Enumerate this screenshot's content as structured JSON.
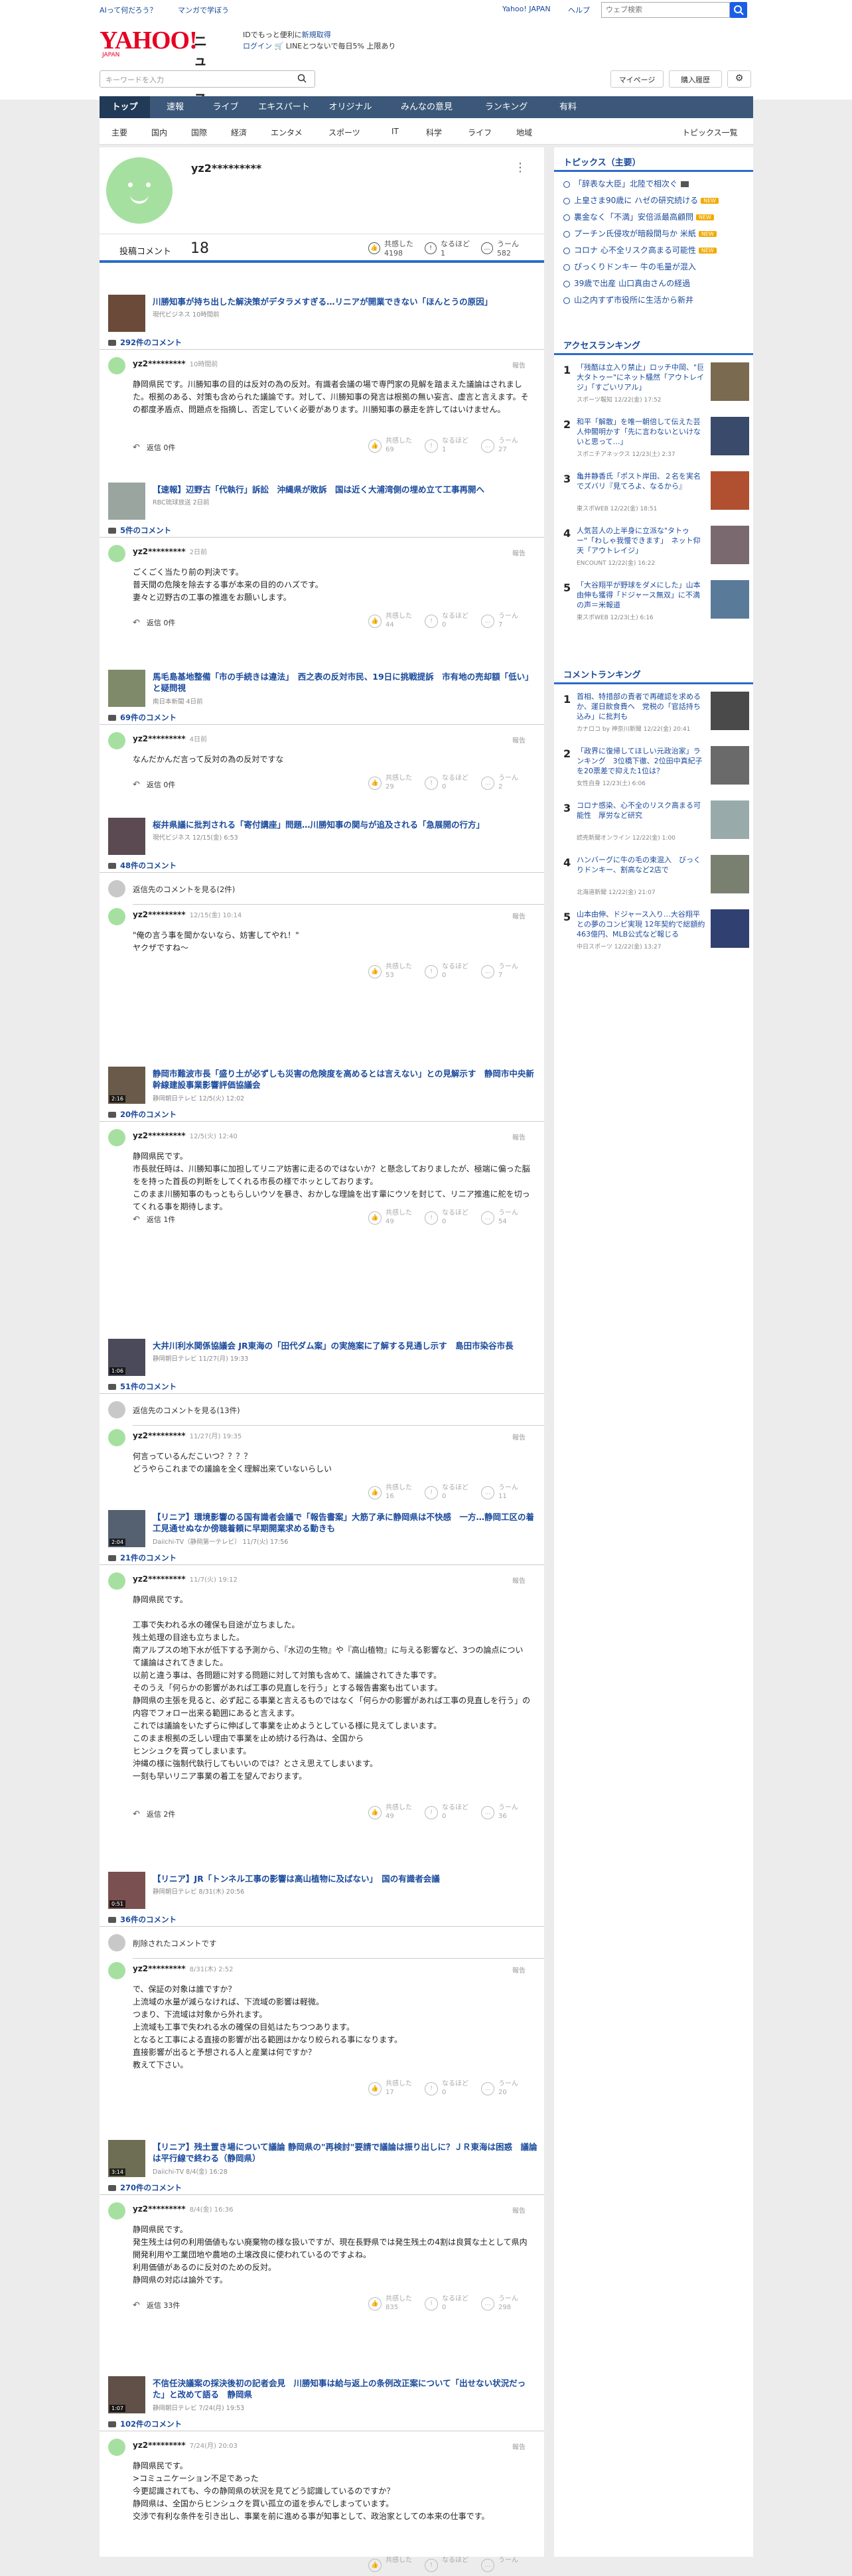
{
  "header": {
    "util_left": [
      "AIって何だろう？",
      "マンガで学ぼう"
    ],
    "util_right": [
      "Yahoo! JAPAN",
      "ヘルプ"
    ],
    "search_placeholder": "ウェブ検索",
    "logo": "YAHOO!",
    "logo_sub": "JAPAN",
    "logo_news": "ニュース",
    "promo_line1": "IDでもっと便利に",
    "promo_line1_link": "新規取得",
    "promo_line2_link": "ログイン",
    "promo_line2": "🛒 LINEとつないで毎日5% ",
    "promo_line2_tail": "上限あり",
    "keyword_placeholder": "キーワードを入力",
    "mypage": "マイページ",
    "subscribe": "購入履歴"
  },
  "nav": [
    "トップ",
    "速報",
    "ライブ",
    "エキスパート",
    "オリジナル",
    "みんなの意見",
    "ランキング",
    "有料"
  ],
  "subnav": [
    "主要",
    "国内",
    "国際",
    "経済",
    "エンタメ",
    "スポーツ",
    "IT",
    "科学",
    "ライフ",
    "地域"
  ],
  "subnav_right": "トピックス一覧",
  "profile": {
    "name": "yz2*********",
    "menu": "⋮",
    "posts_label": "投稿コメント",
    "posts": "18",
    "r1_label": "共感した",
    "r1": "4198",
    "r2_label": "なるほど",
    "r2": "1",
    "r3_label": "うーん",
    "r3": "582"
  },
  "articles": [
    {
      "title": "川勝知事が持ち出した解決策がデタラメすぎる…リニアが開業できない「ほんとうの原因」",
      "src": "現代ビジネス 10時間前",
      "count": "292件のコメント",
      "user": "yz2*********",
      "time": "10時間前",
      "body": "静岡県民です。川勝知事の目的は反対の為の反対。有識者会議の場で専門家の見解を踏まえた議論はされました。根拠のある、対策も含められた議論です。対して、川勝知事の発言は根拠の無い妄言、虚言と言えます。その都度矛盾点、問題点を指摘し、否定していく必要があります。川勝知事の暴走を許してはいけません。",
      "reply": "返信 0件",
      "v1": "69",
      "v2": "1",
      "v3": "27"
    },
    {
      "title": "【速報】辺野古「代執行」訴訟　沖縄県が敗訴　国は近く大浦湾側の埋め立て工事再開へ",
      "src": "RBC琉球放送 2日前",
      "count": "5件のコメント",
      "user": "yz2*********",
      "time": "2日前",
      "body": "ごくごく当たり前の判決です。\n普天間の危険を除去する事が本来の目的のハズです。\n妻々と辺野古の工事の推進をお願いします。",
      "reply": "返信 0件",
      "v1": "44",
      "v2": "0",
      "v3": "7"
    },
    {
      "title": "馬毛島基地整備「市の手続きは違法」　西之表の反対市民、19日に挑戦提訴　市有地の売却額「低い」と疑問視",
      "src": "南日本新聞 4日前",
      "count": "69件のコメント",
      "user": "yz2*********",
      "time": "4日前",
      "body": "なんだかんだ言って反対の為の反対ですな",
      "reply": "返信 0件",
      "v1": "29",
      "v2": "0",
      "v3": "2"
    },
    {
      "title": "桜井県議に批判される「寄付講座」問題…川勝知事の関与が追及される「急展開の行方」",
      "src": "現代ビジネス 12/15(金) 6:53",
      "count": "48件のコメント",
      "see": "返信先のコメントを見る(2件)",
      "user": "yz2*********",
      "time": "12/15(金) 10:14",
      "body": "\"俺の言う事を聞かないなら、妨害してやれ！\"\nヤクザですね〜",
      "v1": "53",
      "v2": "0",
      "v3": "7"
    },
    {
      "title": "静岡市難波市長「盛り土が必ずしも災害の危険度を高めるとは言えない」との見解示す　静岡市中央新幹線建設事業影響評価協議会",
      "src": "静岡朝日テレビ 12/5(火) 12:02",
      "dur": "2:16",
      "count": "20件のコメント",
      "user": "yz2*********",
      "time": "12/5(火) 12:40",
      "body": "静岡県民です。\n市長就任時は、川勝知事に加担してリニア妨害に走るのではないか？と懸念しておりましたが、極端に偏った脳をを持った首長の判断をしてくれる市長の様でホッとしております。\nこのまま川勝知事のもっともらしいウソを暴き、おかしな理論を出す輩にウソを封じて、リニア推進に舵を切ってくれる事を期待します。",
      "reply": "返信 1件",
      "v1": "49",
      "v2": "0",
      "v3": "54"
    },
    {
      "title": "大井川利水関係協議会 JR東海の「田代ダム案」の実施案に了解する見通し示す　島田市染谷市長",
      "src": "静岡朝日テレビ 11/27(月) 19:33",
      "dur": "1:06",
      "count": "51件のコメント",
      "see": "返信先のコメントを見る(13件)",
      "user": "yz2*********",
      "time": "11/27(月) 19:35",
      "body": "何言っているんだこいつ？？？？\nどうやらこれまでの議論を全く理解出来ていないらしい",
      "v1": "16",
      "v2": "0",
      "v3": "11"
    },
    {
      "title": "【リニア】環境影響のる国有識者会議で「報告書案」大筋了承に静岡県は不快感　一方…静岡工区の着工見通せぬなか傍聴着頼に早期開業求める動きも",
      "src": "Daiichi-TV（静岡第一テレビ） 11/7(火) 17:56",
      "dur": "2:04",
      "count": "21件のコメント",
      "user": "yz2*********",
      "time": "11/7(火) 19:12",
      "body": "静岡県民です。\n\n工事で失われる水の確保も目途が立ちました。\n残土処理の目途も立ちました。\n南アルプスの地下水が低下する予測から、『水辺の生物』や『高山植物』に与える影響など、3つの論点について議論はされてきました。\n以前と違う事は、各問題に対する問題に対して対策も含めて、議論されてきた事です。\nそのうえ「何らかの影響があれば工事の見直しを行う」とする報告書案も出ています。\n静岡県の主張を見ると、必ず起こる事業と言えるものではなく「何らかの影響があれば工事の見直しを行う」の内容でフォロー出来る範囲にあると言えます。\nこれでは議論をいたずらに伸ばして事業を止めようとしている様に見えてしまいます。\nこのまま根拠の乏しい理由で事業を止め続ける行為は、全国から\nヒンシュクを買ってしまいます。\n沖縄の様に強制代執行してもいいのでは？とさえ思えてしまいます。\n一刻も早いリニア事業の着工を望んでおります。",
      "reply": "返信 2件",
      "v1": "49",
      "v2": "0",
      "v3": "36"
    },
    {
      "title": "【リニア】JR「トンネル工事の影響は高山植物に及ばない」　国の有識者会議",
      "src": "静岡朝日テレビ 8/31(木) 20:56",
      "dur": "0:51",
      "count": "36件のコメント",
      "see": "削除されたコメントです",
      "user": "yz2*********",
      "time": "8/31(木) 2:52",
      "body": "で、保証の対象は誰ですか？\n上流域の水量が減らなければ、下流域の影響は軽微。\nつまり、下流域は対象から外れます。\n上流域も工事で失われる水の確保の目処はたちつつあります。\nとなると工事による直接の影響が出る範囲はかなり絞られる事になります。\n直接影響が出ると予想される人と産業は何ですか？\n教えて下さい。",
      "v1": "17",
      "v2": "0",
      "v3": "20"
    },
    {
      "title": "【リニア】残土置き場について議論 静岡県の\"再検討\"要請で議論は振り出しに？ＪＲ東海は困惑　議論は平行線で終わる（静岡県）",
      "src": "Daiichi-TV 8/4(金) 16:28",
      "dur": "3:14",
      "count": "270件のコメント",
      "user": "yz2*********",
      "time": "8/4(金) 16:36",
      "body": "静岡県民です。\n発生残土は何の利用価値もない廃棄物の様な扱いですが、現在長野県では発生残土の4割は良質な土として県内開発利用や工業団地や農地の土壌改良に使われているのですよね。\n利用価値があるのに反対のための反対。\n静岡県の対応は論外です。",
      "reply": "返信 33件",
      "v1": "835",
      "v2": "0",
      "v3": "298"
    },
    {
      "title": "不信任決議案の採決後初の記者会見　川勝知事は給与返上の条例改正案について「出せない状況だった」と改めて語る　静岡県",
      "src": "静岡朝日テレビ 7/24(月) 19:53",
      "dur": "1:07",
      "count": "102件のコメント",
      "user": "yz2*********",
      "time": "7/24(月) 20:03",
      "body": "静岡県民です。\n>コミュニケーション不足であった\n今更認識されても、今の静岡県の状況を見てどう認識しているのですか？\n静岡県は、全国からヒンシュクを買い孤立の道を歩んでしまっています。\n交渉で有利な条件を引き出し、事業を前に進める事が知事として、政治家としての本来の仕事です。"
    }
  ],
  "side": {
    "topics_head": "トピックス（主要）",
    "topics": [
      "「辞表な大臣」北陸で相次ぐ",
      "上皇さま90歳に ハゼの研究続ける",
      "裏金なく「不満」安倍派最高顧問",
      "プーチン氏侵攻が暗殺間与か 米紙",
      "コロナ 心不全リスク高まる可能性",
      "ぴっくりドンキー 牛の毛量が混入",
      "39歳で出産 山口真由さんの経過",
      "山之内すず市役所に生活から新井"
    ],
    "new": "NEW",
    "ranking_head": "アクセスランキング",
    "ranking": [
      {
        "t": "「残酷は立入り禁止」ロッチ中岡、\"巨大タトゥー\"にネット騒然「アウトレイジ」「すごいリアル」",
        "s": "スポーツ報知 12/22(金) 17:52"
      },
      {
        "t": "和平「解散」を唯一朝倍して伝えた芸人仲閣明かす「先に言わないといけないと思って…」",
        "s": "スポニチアネックス 12/23(土) 2:37"
      },
      {
        "t": "亀井静香氏「ポスト岸田、２名を実名でズバリ『見てろよ、なるから』",
        "s": "東スポWEB 12/22(金) 18:51"
      },
      {
        "t": "人気芸人の上半身に立派な\"タトゥー\"「わしゃ我慢できます」　ネット仰天「アウトレイジ」",
        "s": "ENCOUNT 12/22(金) 16:22"
      },
      {
        "t": "「大谷翔平が野球をダメにした」山本由伸も獲得「ドジャース無双」に不満の声＝米報道",
        "s": "東スポWEB 12/23(土) 6:16"
      }
    ],
    "cranking_head": "コメントランキング",
    "cranking": [
      {
        "t": "首相、特措部の責者で再確認を求めるか、運日飲食費へ　党税の「官話持ち込み」に批判も",
        "s": "カナロコ by 神奈川新聞 12/22(金) 20:41"
      },
      {
        "t": "「政界に復帰してほしい元政治家」ランキング　3位橋下徹、2位田中真紀子を20票差で抑えた1位は？",
        "s": "女性自身 12/23(土) 6:06"
      },
      {
        "t": "コロナ感染、心不全のリスク高まる可能性　厚労など研究",
        "s": "読売新聞オンライン 12/22(金) 1:00"
      },
      {
        "t": "ハンバーグに牛の毛の束混入　びっくりドンキー、割高など2店で",
        "s": "北海道新聞 12/22(金) 21:07"
      },
      {
        "t": "山本由伸、ドジャース入り…大谷翔平との夢のコンビ実現 12年契約で総額約463億円、MLB公式など報じる",
        "s": "中日スポーツ 12/22(金) 13:27"
      }
    ]
  }
}
